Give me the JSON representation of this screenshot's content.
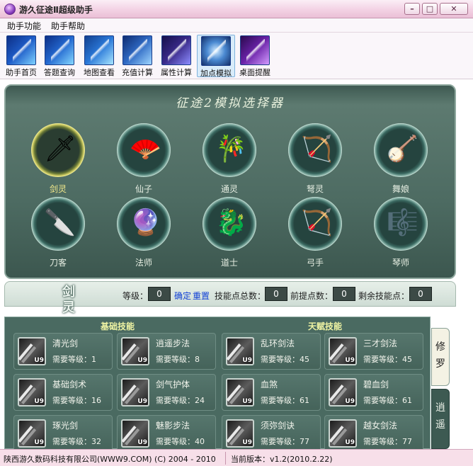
{
  "window": {
    "title": "游久征途Ⅱ超级助手",
    "min_glyph": "–",
    "max_glyph": "□",
    "close_glyph": "✕"
  },
  "menu": [
    "助手功能",
    "助手帮助"
  ],
  "toolbar": [
    {
      "label": "助手首页",
      "icon": "lightning-home-icon",
      "color": "#1e5cc8",
      "active": false
    },
    {
      "label": "答题查询",
      "icon": "lightning-quiz-icon",
      "color": "#2368d0",
      "active": false
    },
    {
      "label": "地图查看",
      "icon": "lightning-map-icon",
      "color": "#2a78d8",
      "active": false
    },
    {
      "label": "充值计算",
      "icon": "lightning-recharge-icon",
      "color": "#2f6ac4",
      "active": false
    },
    {
      "label": "属性计算",
      "icon": "crystal-stats-icon",
      "color": "#3a2a8a",
      "active": false
    },
    {
      "label": "加点模拟",
      "icon": "crown-skill-icon",
      "color": "#1f4f9a",
      "active": true
    },
    {
      "label": "桌面提醒",
      "icon": "purple-flame-reminder-icon",
      "color": "#6a22a8",
      "active": false
    }
  ],
  "selector": {
    "title": "征途2模拟选择器",
    "classes": [
      {
        "name": "剑灵",
        "icon": "sword-icon",
        "glyph": "🗡",
        "selected": true
      },
      {
        "name": "仙子",
        "icon": "fan-icon",
        "glyph": "🪭",
        "selected": false
      },
      {
        "name": "通灵",
        "icon": "flute-icon",
        "glyph": "🎋",
        "selected": false
      },
      {
        "name": "弩灵",
        "icon": "crossbow-icon",
        "glyph": "🏹",
        "selected": false
      },
      {
        "name": "舞娘",
        "icon": "pipa-icon",
        "glyph": "🪕",
        "selected": false
      },
      {
        "name": "刀客",
        "icon": "blade-icon",
        "glyph": "🔪",
        "selected": false
      },
      {
        "name": "法师",
        "icon": "orb-staff-icon",
        "glyph": "🔮",
        "selected": false
      },
      {
        "name": "道士",
        "icon": "dragon-staff-icon",
        "glyph": "🐉",
        "selected": false
      },
      {
        "name": "弓手",
        "icon": "bow-icon",
        "glyph": "🏹",
        "selected": false
      },
      {
        "name": "琴师",
        "icon": "guqin-icon",
        "glyph": "🎼",
        "selected": false
      }
    ]
  },
  "levelbar": {
    "class_char_1": "剑",
    "class_char_2": "灵",
    "level_label": "等级：",
    "level_value": "0",
    "confirm": "确定",
    "reset": "重置",
    "total_points_label": "技能点总数：",
    "total_points_value": "0",
    "early_points_label": "前提点数：",
    "early_points_value": "0",
    "remaining_label": "剩余技能点：",
    "remaining_value": "0"
  },
  "skills": {
    "basic_header": "基础技能",
    "talent_header": "天赋技能",
    "items": [
      {
        "name": "清光剑",
        "req": "需要等级：1",
        "badge": "U9"
      },
      {
        "name": "逍遥步法",
        "req": "需要等级：8",
        "badge": "U9"
      },
      {
        "name": "乱环剑法",
        "req": "需要等级：45",
        "badge": "U9"
      },
      {
        "name": "三才剑法",
        "req": "需要等级：45",
        "badge": "U9"
      },
      {
        "name": "基础剑术",
        "req": "需要等级：16",
        "badge": "U9"
      },
      {
        "name": "剑气护体",
        "req": "需要等级：24",
        "badge": "U9"
      },
      {
        "name": "血煞",
        "req": "需要等级：61",
        "badge": "U9"
      },
      {
        "name": "碧血剑",
        "req": "需要等级：61",
        "badge": "U9"
      },
      {
        "name": "琢光剑",
        "req": "需要等级：32",
        "badge": "U9"
      },
      {
        "name": "魅影步法",
        "req": "需要等级：40",
        "badge": "U9"
      },
      {
        "name": "须弥剑诀",
        "req": "需要等级：77",
        "badge": "U9"
      },
      {
        "name": "越女剑法",
        "req": "需要等级：77",
        "badge": "U9"
      }
    ]
  },
  "side_tabs": [
    {
      "c1": "修",
      "c2": "罗",
      "active": true
    },
    {
      "c1": "逍",
      "c2": "遥",
      "active": false
    }
  ],
  "status": {
    "company": "陕西游久数码科技有限公司(WWW9.COM) (C) 2004 - 2010",
    "version": "当前版本：v1.2(2010.2.22)"
  }
}
